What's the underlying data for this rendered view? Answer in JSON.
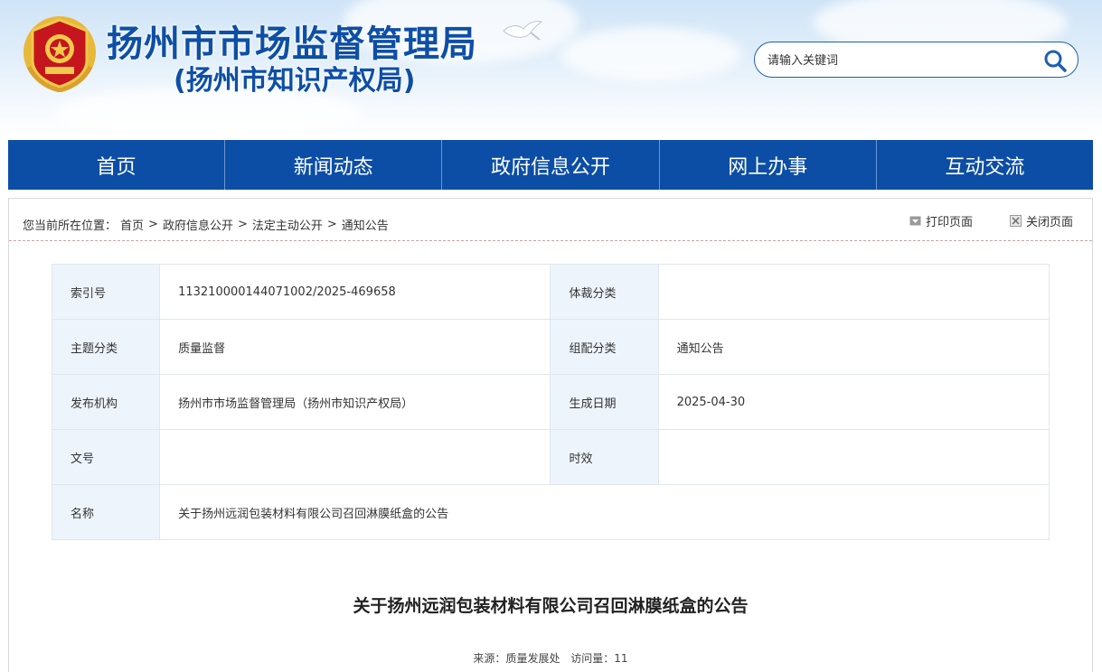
{
  "header": {
    "title": "扬州市市场监督管理局",
    "subtitle": "(扬州市知识产权局)",
    "search_placeholder": "请输入关键词"
  },
  "nav": {
    "items": [
      {
        "label": "首页"
      },
      {
        "label": "新闻动态"
      },
      {
        "label": "政府信息公开"
      },
      {
        "label": "网上办事"
      },
      {
        "label": "互动交流"
      }
    ]
  },
  "breadcrumb": {
    "prefix": "您当前所在位置：",
    "items": [
      "首页",
      "政府信息公开",
      "法定主动公开",
      "通知公告"
    ],
    "separator": ">"
  },
  "tools": {
    "print": "打印页面",
    "close": "关闭页面"
  },
  "info": {
    "index_label": "索引号",
    "index_value": "113210000144071002/2025-469658",
    "genre_label": "体裁分类",
    "genre_value": "",
    "topic_label": "主题分类",
    "topic_value": "质量监督",
    "group_label": "组配分类",
    "group_value": "通知公告",
    "publisher_label": "发布机构",
    "publisher_value": "扬州市市场监督管理局（扬州市知识产权局）",
    "date_label": "生成日期",
    "date_value": "2025-04-30",
    "docno_label": "文号",
    "docno_value": "",
    "validity_label": "时效",
    "validity_value": "",
    "name_label": "名称",
    "name_value": "关于扬州远润包装材料有限公司召回淋膜纸盒的公告"
  },
  "article": {
    "title": "关于扬州远润包装材料有限公司召回淋膜纸盒的公告",
    "source_label": "来源：",
    "source_value": "质量发展处",
    "visits_label": "访问量：",
    "visits_value": "11"
  },
  "colors": {
    "nav_bg": "#0c4ea5",
    "brand_blue": "#0d4fa6",
    "label_cell_bg": "#eef4fc"
  },
  "icons": {
    "emblem": "national-emblem-icon",
    "search": "search-icon",
    "print": "print-icon",
    "close": "close-icon"
  }
}
